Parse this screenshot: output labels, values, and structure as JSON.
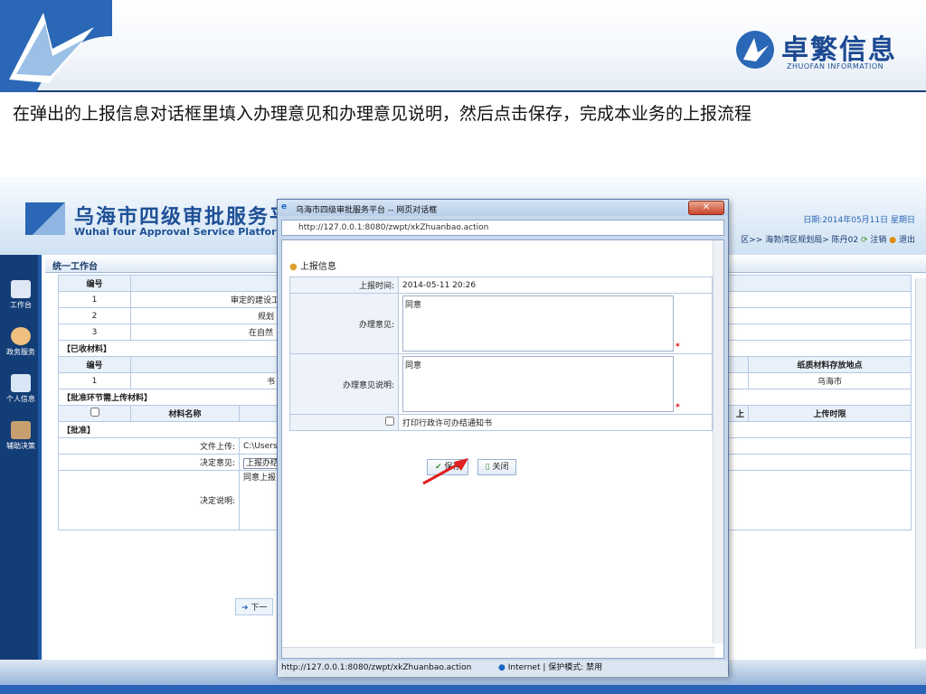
{
  "header": {
    "logo_cn": "卓繁信息",
    "logo_en": "ZHUOFAN INFORMATION"
  },
  "instruction": "在弹出的上报信息对话框里填入办理意见和办理意见说明，然后点击保存，完成本业务的上报流程",
  "app": {
    "title": "乌海市四级审批服务平台",
    "title_en": "Wuhai four Approval Service Platform",
    "date": "日期:2014年05月11日 星期日",
    "user_bar": "区>> 海勃湾区规划局> 陈丹02",
    "logout": "注销",
    "exit": "退出",
    "sidebar": [
      "工作台",
      "政务服务",
      "个人信息",
      "辅助决策"
    ],
    "tab": "统一工作台",
    "table_header_no": "编号",
    "rows": [
      {
        "no": "1",
        "text": "审定的建设工"
      },
      {
        "no": "2",
        "text": "规划"
      },
      {
        "no": "3",
        "text": "在自然"
      }
    ],
    "received": "【已收材料】",
    "received_header_no": "编号",
    "received_row": {
      "no": "1",
      "mid": "书",
      "loc": "乌海市"
    },
    "paper_location_header": "纸质材料存放地点",
    "approve_upload": "【批准环节需上传材料】",
    "material_name": "材料名称",
    "upload_short": "上",
    "upload_time": "上传时限",
    "approve": "【批准】",
    "file_upload_label": "文件上传:",
    "file_upload_value": "C:\\Users\\Administrato",
    "decision_label": "决定意见:",
    "decision_value": "上报办结",
    "decision_note_label": "决定说明:",
    "decision_note_value": "同意上报",
    "next_button": "下一"
  },
  "dialog": {
    "title": "乌海市四级审批服务平台 -- 网页对话框",
    "address": "http://127.0.0.1:8080/zwpt/xkZhuanbao.action",
    "form_title": "上报信息",
    "report_time_label": "上报时间:",
    "report_time_value": "2014-05-11 20:26",
    "opinion_label": "办理意见:",
    "opinion_value": "同意",
    "opinion_note_label": "办理意见说明:",
    "opinion_note_value": "同意",
    "print_notice": "打印行政许可办结通知书",
    "save": "保存",
    "close": "关闭",
    "status_url": "http://127.0.0.1:8080/zwpt/xkZhuanbao.action",
    "status_zone": "Internet | 保护模式: 禁用"
  }
}
